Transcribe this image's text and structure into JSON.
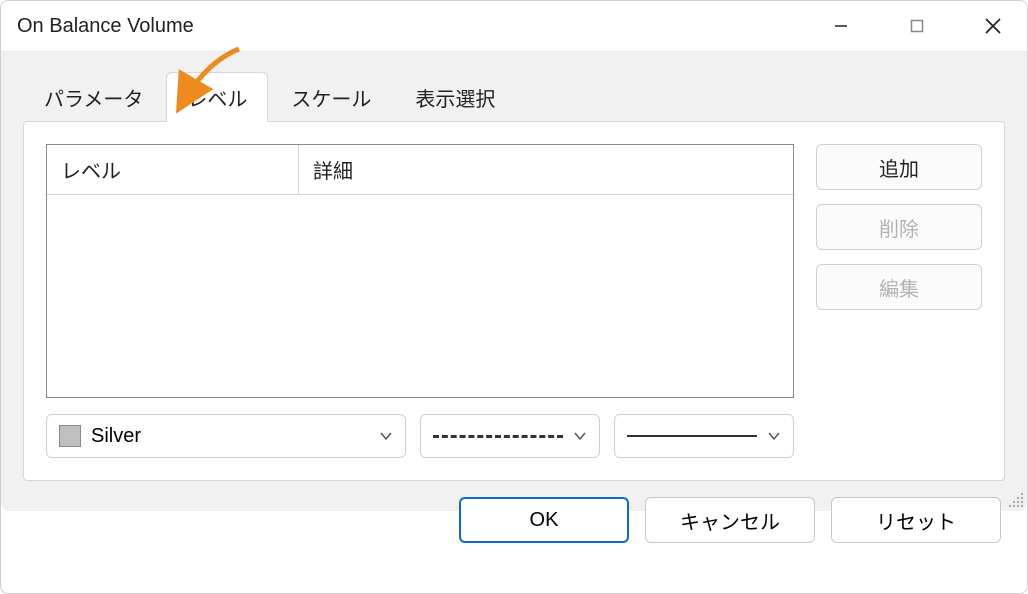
{
  "window": {
    "title": "On Balance Volume"
  },
  "tabs": [
    {
      "label": "パラメータ"
    },
    {
      "label": "レベル"
    },
    {
      "label": "スケール"
    },
    {
      "label": "表示選択"
    }
  ],
  "active_tab_index": 1,
  "table": {
    "headers": {
      "level": "レベル",
      "detail": "詳細"
    }
  },
  "color": {
    "name": "Silver",
    "hex": "#c0c0c0"
  },
  "side_buttons": {
    "add": "追加",
    "delete": "削除",
    "edit": "編集"
  },
  "footer": {
    "ok": "OK",
    "cancel": "キャンセル",
    "reset": "リセット"
  }
}
